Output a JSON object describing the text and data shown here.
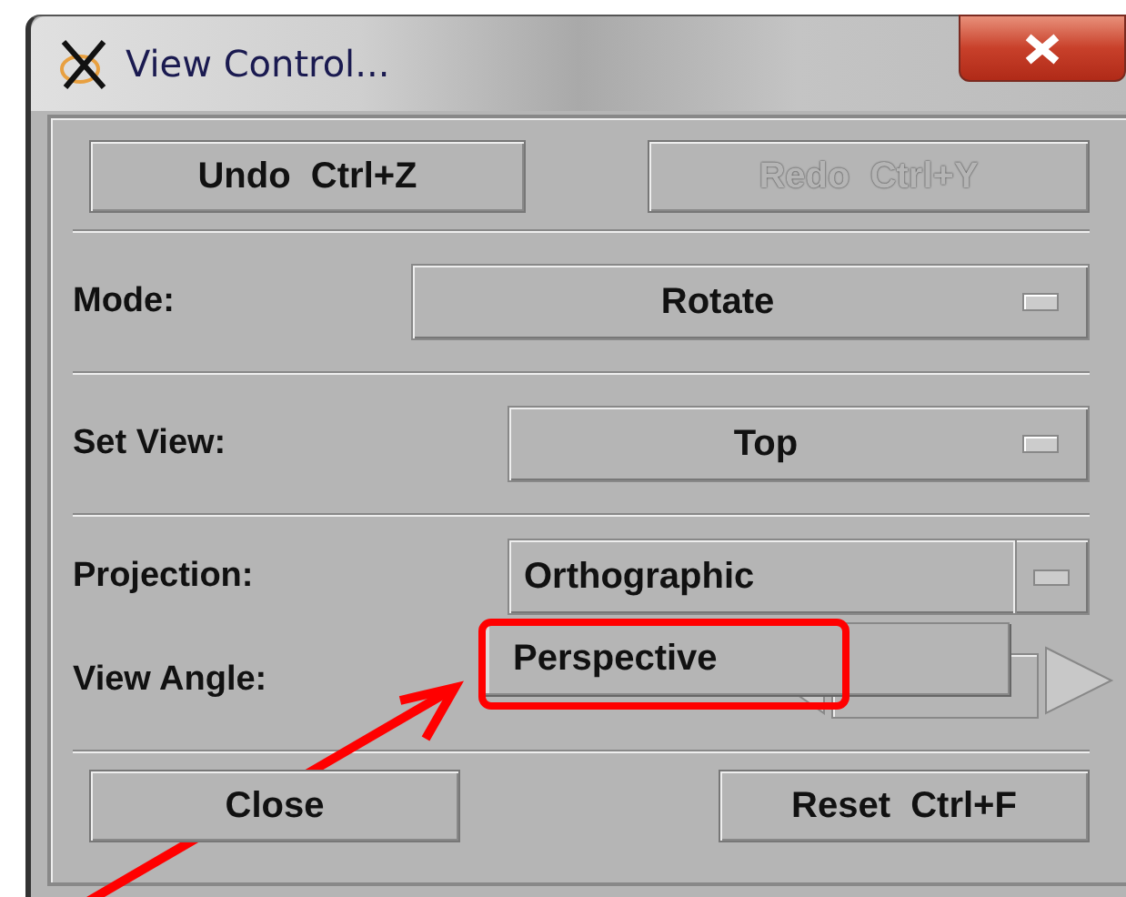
{
  "window": {
    "title": "View Control..."
  },
  "top_buttons": [
    {
      "label": "Undo  Ctrl+Z",
      "disabled": false
    },
    {
      "label": "Redo  Ctrl+Y",
      "disabled": true
    }
  ],
  "mode": {
    "label": "Mode:",
    "value": "Rotate"
  },
  "set_view": {
    "label": "Set View:",
    "value": "Top"
  },
  "projection": {
    "label": "Projection:",
    "value": "Orthographic",
    "expanded": true,
    "options": [
      {
        "label": "Perspective",
        "annotated": true
      }
    ]
  },
  "view_angle": {
    "label": "View Angle:"
  },
  "bottom_buttons": [
    {
      "label": "Close",
      "disabled": false
    },
    {
      "label": "Reset  Ctrl+F",
      "disabled": false
    }
  ]
}
